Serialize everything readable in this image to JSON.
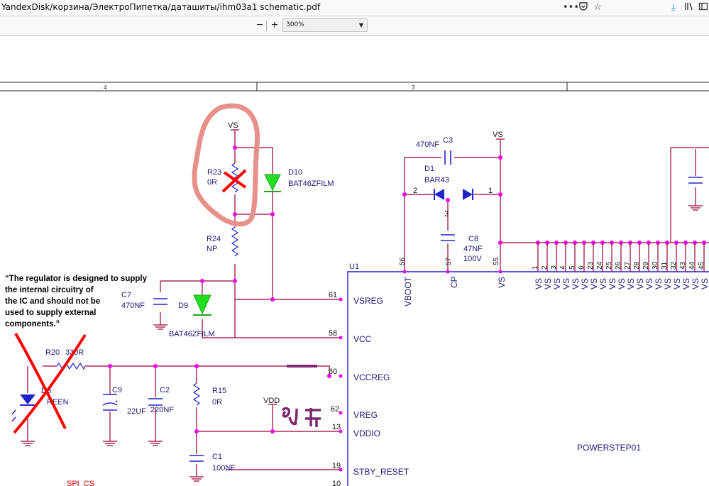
{
  "browser": {
    "url": "YandexDisk/корзина/ЭлектроПипетка/даташиты/ihm03a1 schematic.pdf",
    "icons": {
      "more": "more-horizontal-icon",
      "pocket": "pocket-icon",
      "bookmark": "star-icon",
      "download": "download-icon",
      "library": "library-icon",
      "sidebar": "sidebar-icon"
    }
  },
  "pdf_toolbar": {
    "zoom_out": "−",
    "zoom_in": "+",
    "zoom_value": "300%"
  },
  "frame": {
    "zone_left": "4",
    "zone_right": "3"
  },
  "colors": {
    "wire": "#990033",
    "blue": "#2222cc",
    "pink": "#ee00ee",
    "green": "#22dd22",
    "red": "#ff0000",
    "pale_red": "#e8918c",
    "purple": "#7a2a6e"
  },
  "schematic": {
    "net_vs_1": "VS",
    "net_vs_2": "VS",
    "net_vdd": "VDD",
    "r23": {
      "ref": "R23",
      "value": "0R"
    },
    "d10": {
      "ref": "D10",
      "value": "BAT46ZFILM"
    },
    "r24": {
      "ref": "R24",
      "value": "NP"
    },
    "c7": {
      "ref": "C7",
      "value": "470NF"
    },
    "d9": {
      "ref": "D9",
      "value": "BAT46ZFILM"
    },
    "r20": {
      "ref": "R20",
      "value": "330R"
    },
    "d8": {
      "ref": "D8",
      "value": "REEN"
    },
    "c9": {
      "ref": "C9",
      "value": "22UF",
      "plus": "+"
    },
    "c2": {
      "ref": "C2",
      "value": "220NF"
    },
    "r15": {
      "ref": "R15",
      "value": "0R"
    },
    "c1": {
      "ref": "C1",
      "value": "100NF"
    },
    "c3": {
      "ref": "C3",
      "value": "470NF"
    },
    "d1": {
      "ref": "D1",
      "value": "BAR43",
      "pin2": "2",
      "pin1": "1",
      "pin3": "3"
    },
    "c8": {
      "ref": "C8",
      "value": "47NF",
      "voltage": "100V"
    },
    "u1": {
      "ref": "U1",
      "part": "POWERSTEP01"
    },
    "left_pins": [
      {
        "num": "61",
        "name": "VSREG"
      },
      {
        "num": "58",
        "name": "VCC"
      },
      {
        "num": "60",
        "name": "VCCREG"
      },
      {
        "num": "62",
        "name": "VREG"
      },
      {
        "num": "13",
        "name": "VDDIO"
      },
      {
        "num": "19",
        "name": "STBY_RESET"
      },
      {
        "num": "10",
        "name": ""
      }
    ],
    "top_pins": [
      {
        "num": "56",
        "name": "VBOOT"
      },
      {
        "num": "57",
        "name": "CP"
      },
      {
        "num": "55",
        "name": "VS"
      }
    ],
    "vs_pins": [
      "1",
      "2",
      "3",
      "4",
      "5",
      "6",
      "23",
      "24",
      "25",
      "26",
      "27",
      "28",
      "29",
      "30",
      "31",
      "32",
      "43",
      "44",
      "45"
    ],
    "vs_pin_name": "VS",
    "spi_label": "SPI_CS",
    "annotation": "\"The regulator is designed to supply the internal circuitry of the IC and should not be used to supply external components.\"",
    "annotation_lines": [
      "“The regulator is designed to supply",
      "the internal circuitry of",
      "the IC and should not be",
      "used to supply external",
      "components.”"
    ],
    "scribble_text": "91"
  }
}
